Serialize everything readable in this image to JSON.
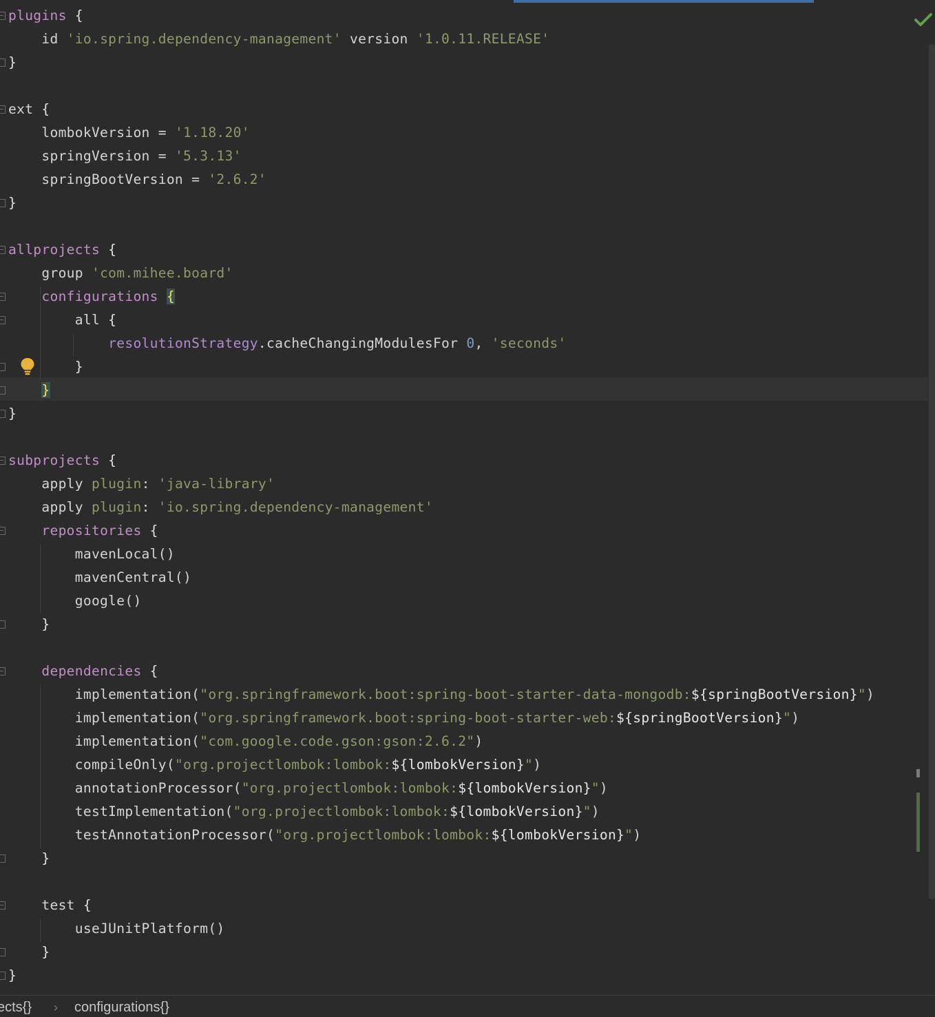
{
  "editor": {
    "lines": [
      [
        [
          "kw",
          "plugins"
        ],
        [
          "plain",
          " "
        ],
        [
          "brace",
          "{"
        ]
      ],
      [
        [
          "plain",
          "    id "
        ],
        [
          "str",
          "'io.spring.dependency-management'"
        ],
        [
          "plain",
          " version "
        ],
        [
          "str",
          "'1.0.11.RELEASE'"
        ]
      ],
      [
        [
          "brace",
          "}"
        ]
      ],
      [],
      [
        [
          "plain",
          "ext "
        ],
        [
          "brace",
          "{"
        ]
      ],
      [
        [
          "plain",
          "    lombokVersion = "
        ],
        [
          "str",
          "'1.18.20'"
        ]
      ],
      [
        [
          "plain",
          "    springVersion = "
        ],
        [
          "str",
          "'5.3.13'"
        ]
      ],
      [
        [
          "plain",
          "    springBootVersion = "
        ],
        [
          "str",
          "'2.6.2'"
        ]
      ],
      [
        [
          "brace",
          "}"
        ]
      ],
      [],
      [
        [
          "kw",
          "allprojects"
        ],
        [
          "plain",
          " "
        ],
        [
          "brace",
          "{"
        ]
      ],
      [
        [
          "plain",
          "    group "
        ],
        [
          "str",
          "'com.mihee.board'"
        ]
      ],
      [
        [
          "plain",
          "    "
        ],
        [
          "kw",
          "configurations"
        ],
        [
          "plain",
          " "
        ],
        [
          "bmatch",
          "{"
        ]
      ],
      [
        [
          "plain",
          "        all "
        ],
        [
          "brace",
          "{"
        ]
      ],
      [
        [
          "plain",
          "            "
        ],
        [
          "field",
          "resolutionStrategy"
        ],
        [
          "plain",
          ".cacheChangingModulesFor "
        ],
        [
          "num",
          "0"
        ],
        [
          "plain",
          ", "
        ],
        [
          "str",
          "'seconds'"
        ]
      ],
      [
        [
          "plain",
          "        "
        ],
        [
          "brace",
          "}"
        ]
      ],
      [
        [
          "plain",
          "    "
        ],
        [
          "bmatch",
          "}"
        ]
      ],
      [
        [
          "brace",
          "}"
        ]
      ],
      [],
      [
        [
          "kw",
          "subprojects"
        ],
        [
          "plain",
          " "
        ],
        [
          "brace",
          "{"
        ]
      ],
      [
        [
          "plain",
          "    apply "
        ],
        [
          "str",
          "plugin"
        ],
        [
          "plain",
          ": "
        ],
        [
          "str",
          "'java-library'"
        ]
      ],
      [
        [
          "plain",
          "    apply "
        ],
        [
          "str",
          "plugin"
        ],
        [
          "plain",
          ": "
        ],
        [
          "str",
          "'io.spring.dependency-management'"
        ]
      ],
      [
        [
          "plain",
          "    "
        ],
        [
          "kw",
          "repositories"
        ],
        [
          "plain",
          " "
        ],
        [
          "brace",
          "{"
        ]
      ],
      [
        [
          "plain",
          "        mavenLocal()"
        ]
      ],
      [
        [
          "plain",
          "        mavenCentral()"
        ]
      ],
      [
        [
          "plain",
          "        google()"
        ]
      ],
      [
        [
          "plain",
          "    "
        ],
        [
          "brace",
          "}"
        ]
      ],
      [],
      [
        [
          "plain",
          "    "
        ],
        [
          "kw",
          "dependencies"
        ],
        [
          "plain",
          " "
        ],
        [
          "brace",
          "{"
        ]
      ],
      [
        [
          "plain",
          "        implementation("
        ],
        [
          "str",
          "\"org.springframework.boot:spring-boot-starter-data-mongodb:"
        ],
        [
          "interp",
          "${springBootVersion}"
        ],
        [
          "str",
          "\""
        ],
        [
          "plain",
          ")"
        ]
      ],
      [
        [
          "plain",
          "        implementation("
        ],
        [
          "str",
          "\"org.springframework.boot:spring-boot-starter-web:"
        ],
        [
          "interp",
          "${springBootVersion}"
        ],
        [
          "str",
          "\""
        ],
        [
          "plain",
          ")"
        ]
      ],
      [
        [
          "plain",
          "        implementation("
        ],
        [
          "str",
          "\"com.google.code.gson:gson:2.6.2\""
        ],
        [
          "plain",
          ")"
        ]
      ],
      [
        [
          "plain",
          "        compileOnly("
        ],
        [
          "str",
          "\"org.projectlombok:lombok:"
        ],
        [
          "interp",
          "${lombokVersion}"
        ],
        [
          "str",
          "\""
        ],
        [
          "plain",
          ")"
        ]
      ],
      [
        [
          "plain",
          "        annotationProcessor("
        ],
        [
          "str",
          "\"org.projectlombok:lombok:"
        ],
        [
          "interp",
          "${lombokVersion}"
        ],
        [
          "str",
          "\""
        ],
        [
          "plain",
          ")"
        ]
      ],
      [
        [
          "plain",
          "        testImplementation("
        ],
        [
          "str",
          "\"org.projectlombok:lombok:"
        ],
        [
          "interp",
          "${lombokVersion}"
        ],
        [
          "str",
          "\""
        ],
        [
          "plain",
          ")"
        ]
      ],
      [
        [
          "plain",
          "        testAnnotationProcessor("
        ],
        [
          "str",
          "\"org.projectlombok:lombok:"
        ],
        [
          "interp",
          "${lombokVersion}"
        ],
        [
          "str",
          "\""
        ],
        [
          "plain",
          ")"
        ]
      ],
      [
        [
          "plain",
          "    "
        ],
        [
          "brace",
          "}"
        ]
      ],
      [],
      [
        [
          "plain",
          "    test "
        ],
        [
          "brace",
          "{"
        ]
      ],
      [
        [
          "plain",
          "        useJUnitPlatform()"
        ]
      ],
      [
        [
          "plain",
          "    "
        ],
        [
          "brace",
          "}"
        ]
      ],
      [
        [
          "brace",
          "}"
        ]
      ]
    ]
  },
  "status": {
    "inspection_icon": "checkmark-icon",
    "inspection_color": "#5f9f4d"
  },
  "gutter": {
    "intention_icon": "lightbulb-icon",
    "intention_color": "#e8b43a"
  },
  "breadcrumb": {
    "items": [
      "ects{}",
      "configurations{}"
    ],
    "separator": "›"
  }
}
